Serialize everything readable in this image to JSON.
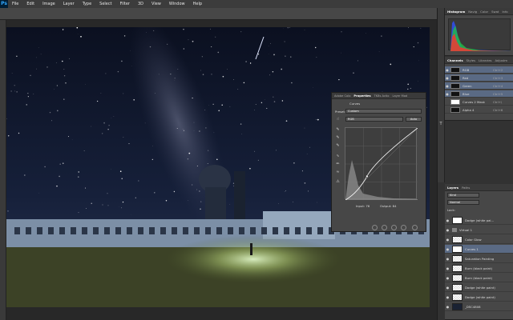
{
  "menu": {
    "logo": "Ps",
    "items": [
      "File",
      "Edit",
      "Image",
      "Layer",
      "Type",
      "Select",
      "Filter",
      "3D",
      "View",
      "Window",
      "Help"
    ]
  },
  "histogram": {
    "tabs": [
      "Histogram",
      "Navig",
      "Color",
      "Swat",
      "Info"
    ]
  },
  "channels": {
    "tabs": [
      "Channels",
      "Styles",
      "Libraries",
      "Adjustm"
    ],
    "rows": [
      {
        "name": "RGB",
        "key": "Ctrl+2",
        "thumb": "dark",
        "selected": true
      },
      {
        "name": "Red",
        "key": "Ctrl+3",
        "thumb": "dark",
        "selected": true
      },
      {
        "name": "Green",
        "key": "Ctrl+4",
        "thumb": "dark",
        "selected": true
      },
      {
        "name": "Blue",
        "key": "Ctrl+5",
        "thumb": "dark",
        "selected": true
      },
      {
        "name": "Curves 2 Mask",
        "key": "Ctrl+\\",
        "thumb": "white",
        "selected": false
      },
      {
        "name": "Alpha 4",
        "key": "Ctrl+6",
        "thumb": "dark",
        "selected": false
      }
    ]
  },
  "properties": {
    "tabs": [
      "Adobe Colo",
      "Properties",
      "TK8s Actio",
      "Layer Mod"
    ],
    "title": "Curves",
    "preset_label": "Preset:",
    "preset_value": "Custom",
    "channel_value": "RGB",
    "auto_label": "Auto",
    "input_label": "Input: 76",
    "output_label": "Output: 84"
  },
  "layers": {
    "tabs": [
      "Layers",
      "Paths"
    ],
    "kind_label": "Kind",
    "blend_value": "Normal",
    "lock_label": "Lock:",
    "rows": [
      {
        "name": "Dodge (white pai...",
        "thumb": "white",
        "type": "layer",
        "selected": false
      },
      {
        "name": "Virtual 1",
        "thumb": "",
        "type": "folder",
        "selected": false
      },
      {
        "name": "Color Glow",
        "thumb": "",
        "type": "layer",
        "selected": false
      },
      {
        "name": "Curves 1",
        "thumb": "white",
        "type": "layer",
        "selected": true
      },
      {
        "name": "Saturation Painting",
        "thumb": "",
        "type": "layer",
        "selected": false
      },
      {
        "name": "Burn (black paint)",
        "thumb": "",
        "type": "layer",
        "selected": false
      },
      {
        "name": "Burn (black paint)",
        "thumb": "",
        "type": "layer",
        "selected": false
      },
      {
        "name": "Dodge (white paint)",
        "thumb": "",
        "type": "layer",
        "selected": false
      },
      {
        "name": "Dodge (white paint)",
        "thumb": "",
        "type": "layer",
        "selected": false
      },
      {
        "name": "_DSC4808",
        "thumb": "dark",
        "type": "layer",
        "selected": false
      }
    ]
  },
  "curve": {
    "points_in": [
      0,
      76,
      255
    ],
    "points_out": [
      0,
      84,
      255
    ]
  },
  "colors": {
    "accent": "#5a6a84",
    "panel": "#474747"
  }
}
